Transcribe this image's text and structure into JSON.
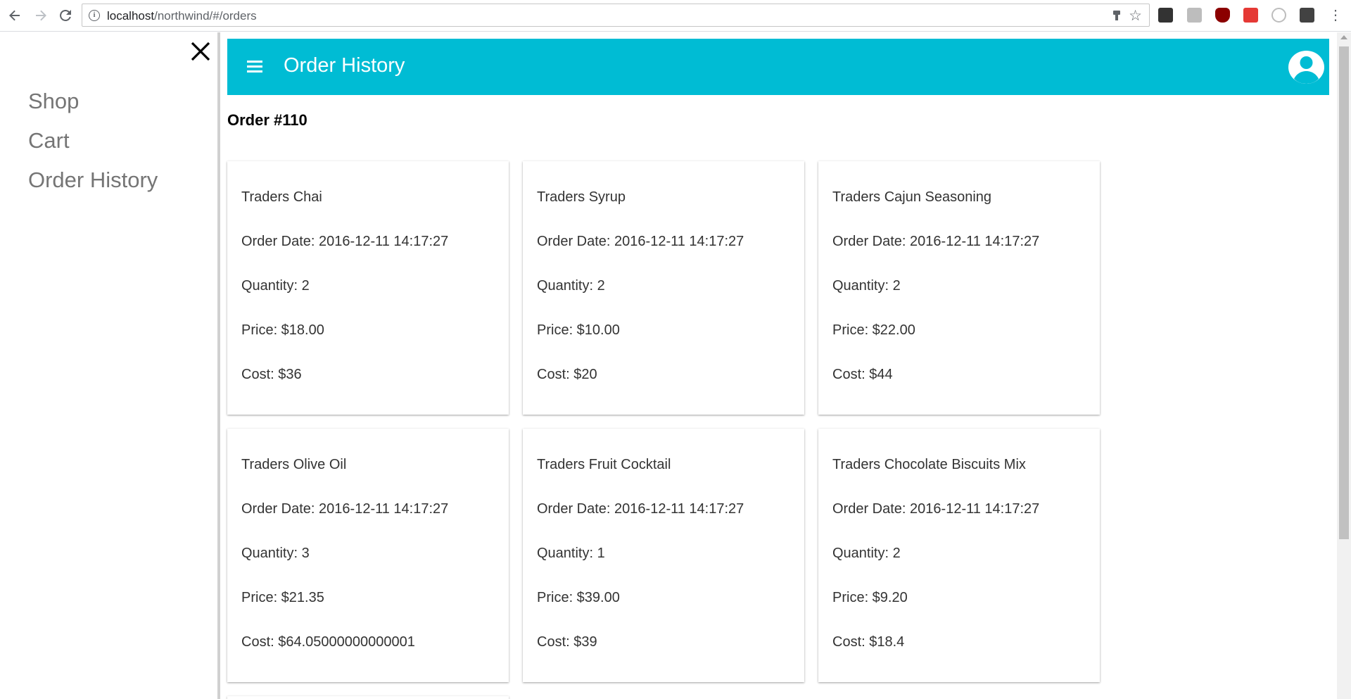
{
  "browser": {
    "url_host": "localhost",
    "url_path": "/northwind/#/orders"
  },
  "sidebar": {
    "items": [
      {
        "label": "Shop"
      },
      {
        "label": "Cart"
      },
      {
        "label": "Order History"
      }
    ]
  },
  "toolbar": {
    "title": "Order History",
    "accent_color": "#00bcd4"
  },
  "order": {
    "title": "Order #110",
    "items": [
      {
        "name": "Traders Chai",
        "date": "Order Date: 2016-12-11 14:17:27",
        "quantity": "Quantity: 2",
        "price": "Price: $18.00",
        "cost": "Cost: $36"
      },
      {
        "name": "Traders Syrup",
        "date": "Order Date: 2016-12-11 14:17:27",
        "quantity": "Quantity: 2",
        "price": "Price: $10.00",
        "cost": "Cost: $20"
      },
      {
        "name": "Traders Cajun Seasoning",
        "date": "Order Date: 2016-12-11 14:17:27",
        "quantity": "Quantity: 2",
        "price": "Price: $22.00",
        "cost": "Cost: $44"
      },
      {
        "name": "Traders Olive Oil",
        "date": "Order Date: 2016-12-11 14:17:27",
        "quantity": "Quantity: 3",
        "price": "Price: $21.35",
        "cost": "Cost: $64.05000000000001"
      },
      {
        "name": "Traders Fruit Cocktail",
        "date": "Order Date: 2016-12-11 14:17:27",
        "quantity": "Quantity: 1",
        "price": "Price: $39.00",
        "cost": "Cost: $39"
      },
      {
        "name": "Traders Chocolate Biscuits Mix",
        "date": "Order Date: 2016-12-11 14:17:27",
        "quantity": "Quantity: 2",
        "price": "Price: $9.20",
        "cost": "Cost: $18.4"
      }
    ]
  }
}
